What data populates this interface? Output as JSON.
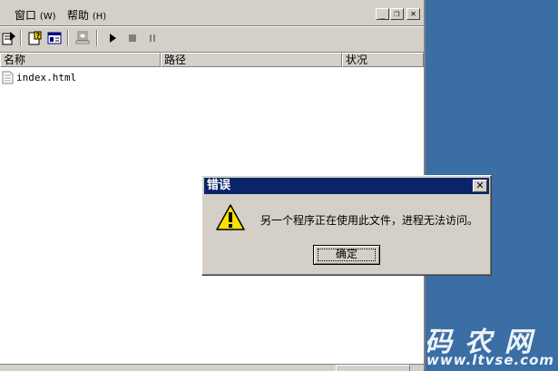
{
  "menu": {
    "window_label": "窗口",
    "window_key": "(W)",
    "help_label": "帮助",
    "help_key": "(H)"
  },
  "window_controls": {
    "minimize": "_",
    "restore": "❐",
    "close": "✕"
  },
  "columns": [
    {
      "label": "名称"
    },
    {
      "label": "路径"
    },
    {
      "label": "状况"
    }
  ],
  "files": [
    {
      "name": "index.html"
    }
  ],
  "dialog": {
    "title": "错误",
    "close": "✕",
    "message": "另一个程序正在使用此文件，进程无法访问。",
    "ok_label": "确定"
  },
  "watermark": {
    "text": "码农网",
    "url": "www.ltvse.com"
  },
  "colors": {
    "desktop": "#3a6ea5",
    "face": "#d4d0c8",
    "titlebar": "#0a246a"
  }
}
